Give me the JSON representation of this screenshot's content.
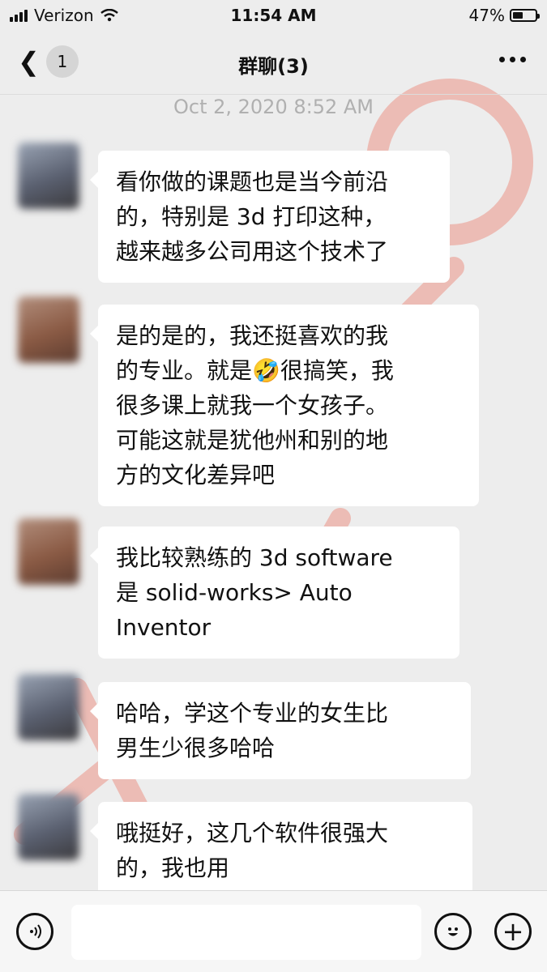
{
  "status_bar": {
    "carrier": "Verizon",
    "time": "11:54 AM",
    "battery_percent": "47%",
    "battery_level": 0.47
  },
  "header": {
    "back_icon": "chevron-left-icon",
    "unread_count": "1",
    "title": "群聊(3)",
    "more_icon": "more-dots-icon"
  },
  "chat": {
    "timestamp": "Oct 2, 2020 8:52 AM",
    "messages": [
      {
        "text": "看你做的课题也是当今前沿\n的，特别是 3d 打印这种，\n越来越多公司用这个技术了"
      },
      {
        "text": "是的是的，我还挺喜欢的我\n的专业。就是🤣很搞笑，我\n很多课上就我一个女孩子。\n可能这就是犹他州和别的地\n方的文化差异吧"
      },
      {
        "text": "我比较熟练的 3d software\n是 solid-works> Auto\nInventor"
      },
      {
        "text": "哈哈，学这个专业的女生比\n男生少很多哈哈"
      },
      {
        "text": "哦挺好，这几个软件很强大\n的，我也用"
      }
    ]
  },
  "input_bar": {
    "voice_icon": "voice-icon",
    "input_value": "",
    "emoji_icon": "emoji-icon",
    "plus_icon": "plus-icon"
  },
  "colors": {
    "background": "#ededed",
    "bubble": "#ffffff",
    "watermark": "#e8543f"
  }
}
